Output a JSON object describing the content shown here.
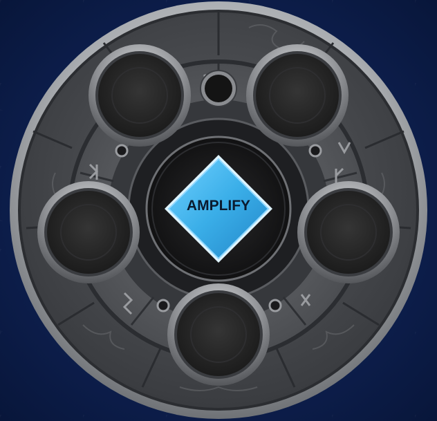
{
  "center_button": {
    "label": "AMPLIFY",
    "color": "#3aaee8",
    "border_color": "#bfe8ff"
  },
  "slots": [
    {
      "name": "slot-top-left",
      "state": "empty"
    },
    {
      "name": "slot-top-right",
      "state": "empty"
    },
    {
      "name": "slot-left",
      "state": "empty"
    },
    {
      "name": "slot-right",
      "state": "empty"
    },
    {
      "name": "slot-bottom",
      "state": "empty"
    }
  ],
  "small_sockets": [
    {
      "name": "socket-top",
      "state": "empty"
    }
  ],
  "colors": {
    "background": "#0e2050",
    "rim": "#b9bcc0",
    "stone": "#4a4c50",
    "slot_fill": "#2a2a2a",
    "accent": "#3aaee8"
  },
  "icons": [
    "rune-icon",
    "knot-icon"
  ]
}
